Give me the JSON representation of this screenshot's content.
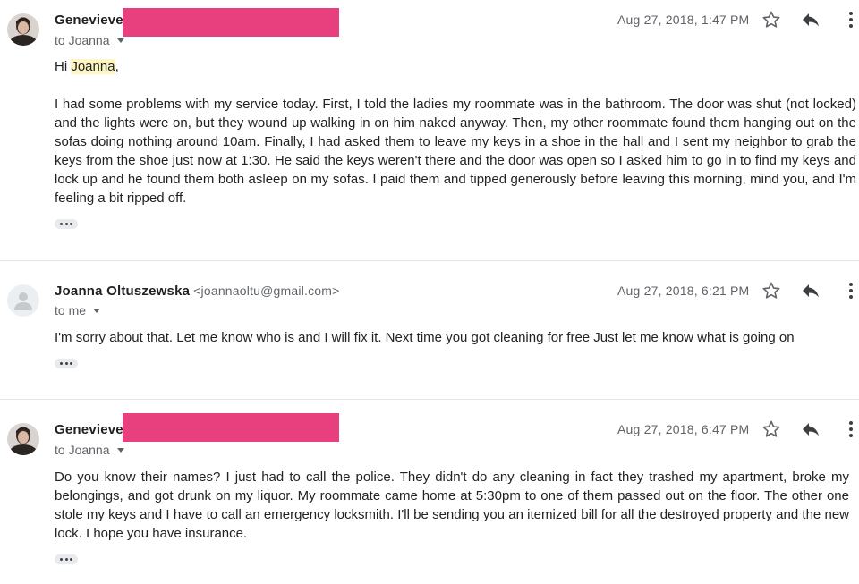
{
  "messages": [
    {
      "sender": "Genevieve",
      "email": "",
      "to": "to Joanna",
      "date": "Aug 27, 2018, 1:47 PM",
      "greeting_prefix": "Hi ",
      "greeting_name": "Joanna",
      "greeting_suffix": ",",
      "body": "I had some problems with my service today.  First, I told the ladies my roommate was in the bathroom.  The door was shut (not locked) and the lights were on, but they wound up walking in on him naked anyway.  Then, my other roommate found them hanging out on the sofas doing nothing around 10am.  Finally, I had asked them to leave my keys in a shoe in the hall and I sent my neighbor to grab the keys from the shoe just now at 1:30.  He said the keys weren't there and the door was open so I asked him to go in to find my keys and lock up and he found them both asleep on my sofas.  I paid them and tipped generously before leaving this morning, mind you, and I'm feeling a bit ripped off."
    },
    {
      "sender": "Joanna Oltuszewska",
      "email": "<joannaoltu@gmail.com>",
      "to": "to me",
      "date": "Aug 27, 2018, 6:21 PM",
      "body": "I'm sorry about that. Let me know who is and I will fix it. Next time you got cleaning for free  Just let me know what is going on"
    },
    {
      "sender": "Genevieve",
      "email": "",
      "to": "to Joanna",
      "date": "Aug 27, 2018, 6:47 PM",
      "body": "Do you know their names? I just had to call the police. They didn't do any cleaning in fact they trashed my apartment, broke my belongings, and got drunk on my liquor. My roommate came home at 5:30pm to one of them passed out on the floor.  The other one stole my keys and I have to call an emergency locksmith. I'll be sending you an itemized bill for all the destroyed property and the new lock. I hope you have insurance."
    }
  ],
  "colors": {
    "redaction": "#e8407f",
    "highlight": "#fdf5c3",
    "meta_text": "#5f6368"
  },
  "icons": [
    "avatar-photo",
    "avatar-default",
    "star-icon",
    "reply-icon",
    "more-vert-icon",
    "chevron-down-icon",
    "ellipsis-icon"
  ]
}
